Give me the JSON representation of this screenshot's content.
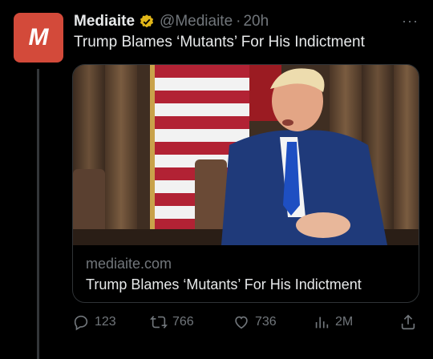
{
  "tweet": {
    "avatar_letter": "M",
    "author_name": "Mediaite",
    "handle": "@Mediaite",
    "separator": "·",
    "time": "20h",
    "more": "···",
    "text": "Trump Blames ‘Mutants’ For His Indictment"
  },
  "card": {
    "domain": "mediaite.com",
    "title": "Trump Blames ‘Mutants’ For His Indictment"
  },
  "actions": {
    "replies": "123",
    "retweets": "766",
    "likes": "736",
    "views": "2M"
  },
  "colors": {
    "background": "#000000",
    "avatar_bg": "#d34a3a",
    "verified_badge": "#e2b719",
    "secondary_text": "#71767b"
  },
  "icons": [
    "verified-badge-icon",
    "more-icon",
    "reply-icon",
    "retweet-icon",
    "like-icon",
    "views-icon",
    "share-icon"
  ]
}
